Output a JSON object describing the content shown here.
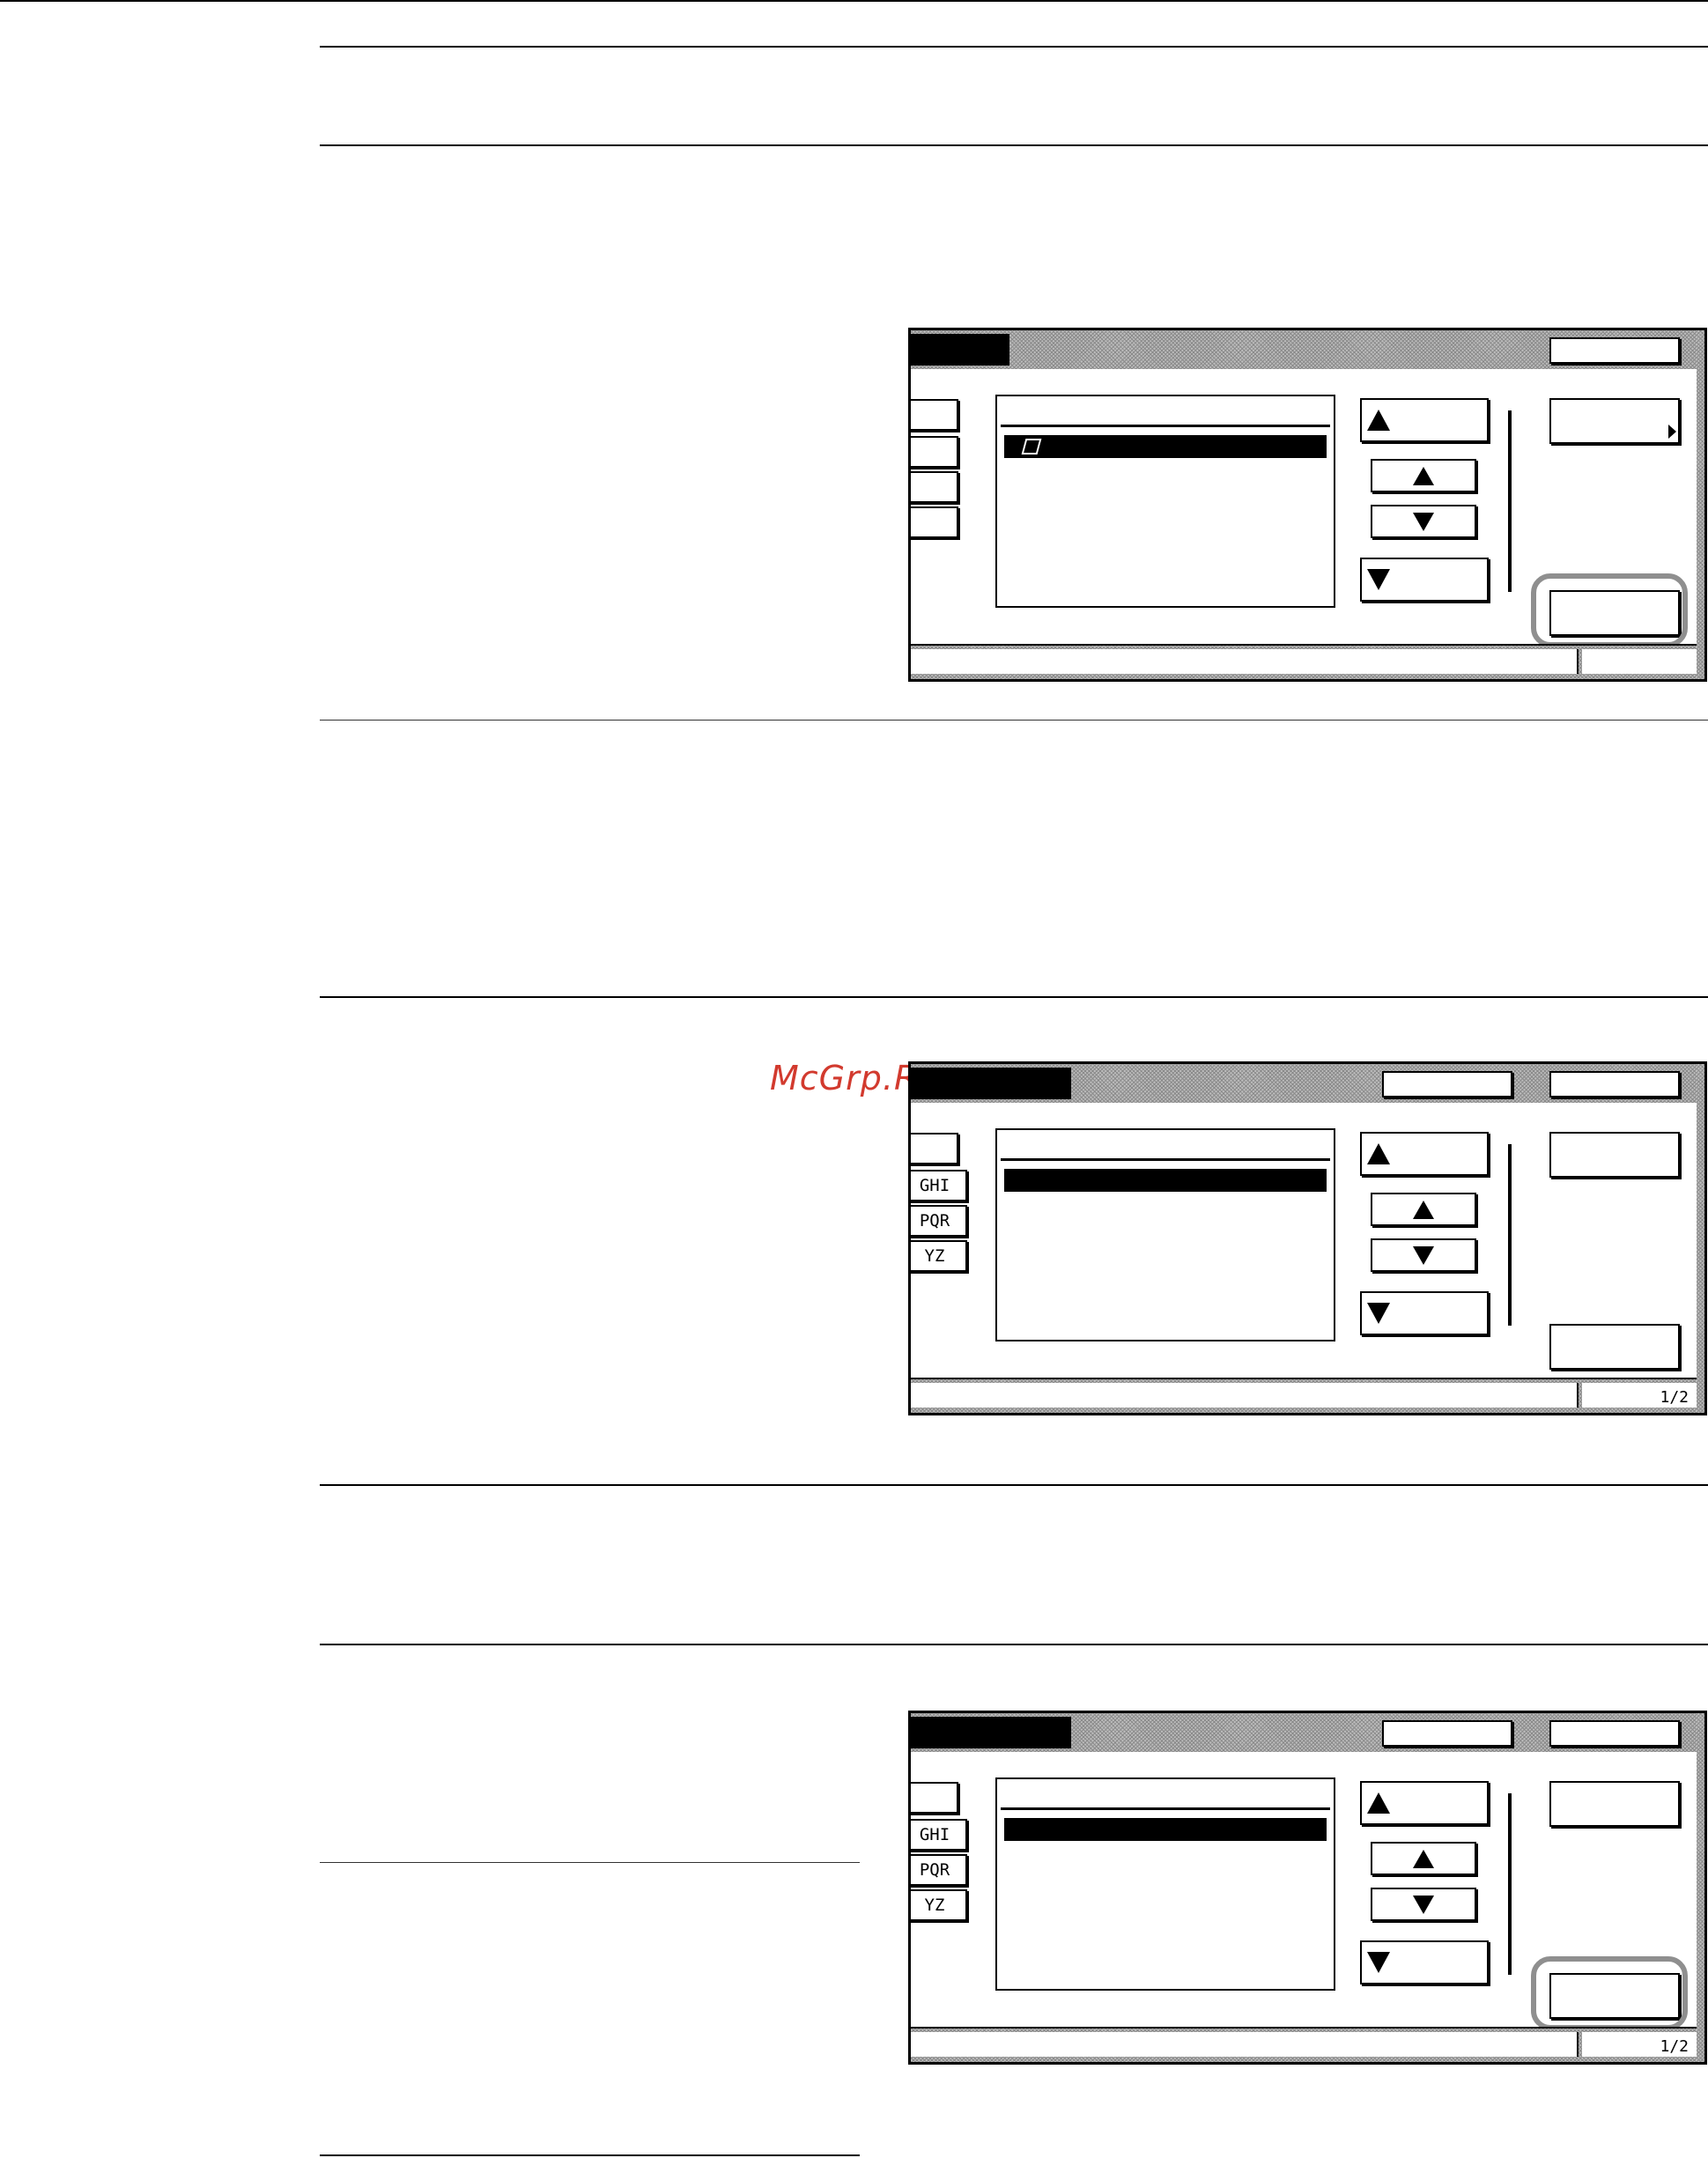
{
  "watermark": "McGrp.Ru",
  "panels": [
    {
      "id": "screen-1",
      "left_tabs": [
        "",
        "",
        "",
        ""
      ],
      "page_indicator": "",
      "has_folder_row": true
    },
    {
      "id": "screen-2",
      "left_tabs": [
        "",
        "GHI",
        "PQR",
        "YZ"
      ],
      "page_indicator": "1/2",
      "has_folder_row": false
    },
    {
      "id": "screen-3",
      "left_tabs": [
        "",
        "GHI",
        "PQR",
        "YZ"
      ],
      "page_indicator": "1/2",
      "has_folder_row": false
    }
  ]
}
